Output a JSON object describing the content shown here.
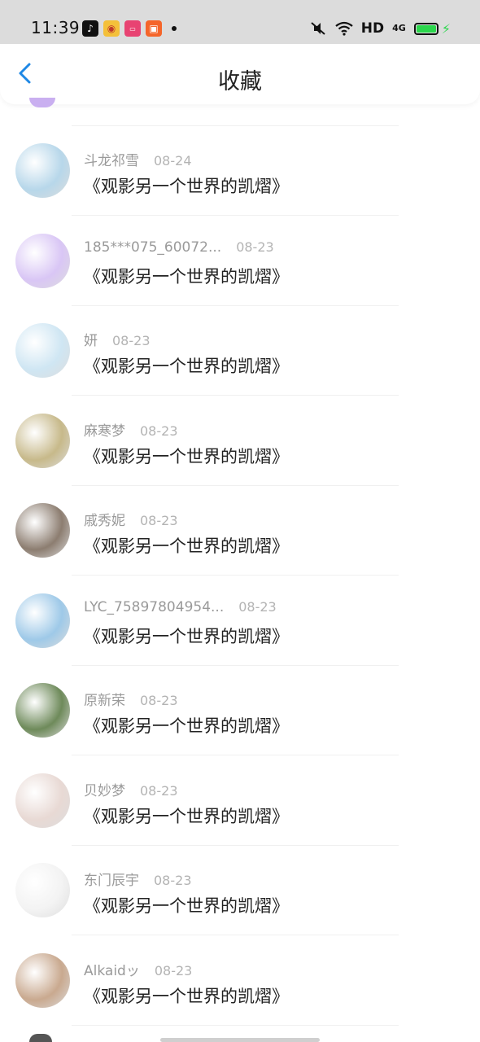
{
  "status_bar": {
    "time": "11:39",
    "network": "HD",
    "signal": "4G",
    "colors": {
      "battery": "#2bd64c"
    }
  },
  "header": {
    "title": "收藏",
    "back_icon": "chevron-left-icon",
    "accent_color": "#1e88e5"
  },
  "items": [
    {
      "user": "斗龙祁雪",
      "date": "08-24",
      "title": "《观影另一个世界的凯熠》",
      "avatar_color": "#b7d7ea"
    },
    {
      "user": "185***075_60072...",
      "date": "08-23",
      "title": "《观影另一个世界的凯熠》",
      "avatar_color": "#d9c6f5"
    },
    {
      "user": "妍",
      "date": "08-23",
      "title": "《观影另一个世界的凯熠》",
      "avatar_color": "#cfe6f3"
    },
    {
      "user": "麻寒梦",
      "date": "08-23",
      "title": "《观影另一个世界的凯熠》",
      "avatar_color": "#c7b98a"
    },
    {
      "user": "戚秀妮",
      "date": "08-23",
      "title": "《观影另一个世界的凯熠》",
      "avatar_color": "#8c7d70"
    },
    {
      "user": "LYC_75897804954...",
      "date": "08-23",
      "title": "《观影另一个世界的凯熠》",
      "avatar_color": "#9ec9e8"
    },
    {
      "user": "原新荣",
      "date": "08-23",
      "title": "《观影另一个世界的凯熠》",
      "avatar_color": "#6e8a5a"
    },
    {
      "user": "贝妙梦",
      "date": "08-23",
      "title": "《观影另一个世界的凯熠》",
      "avatar_color": "#e8d9d4"
    },
    {
      "user": "东门辰宇",
      "date": "08-23",
      "title": "《观影另一个世界的凯熠》",
      "avatar_color": "#f3f3f3"
    },
    {
      "user": "Alkaidッ",
      "date": "08-23",
      "title": "《观影另一个世界的凯熠》",
      "avatar_color": "#c9a98f"
    }
  ]
}
